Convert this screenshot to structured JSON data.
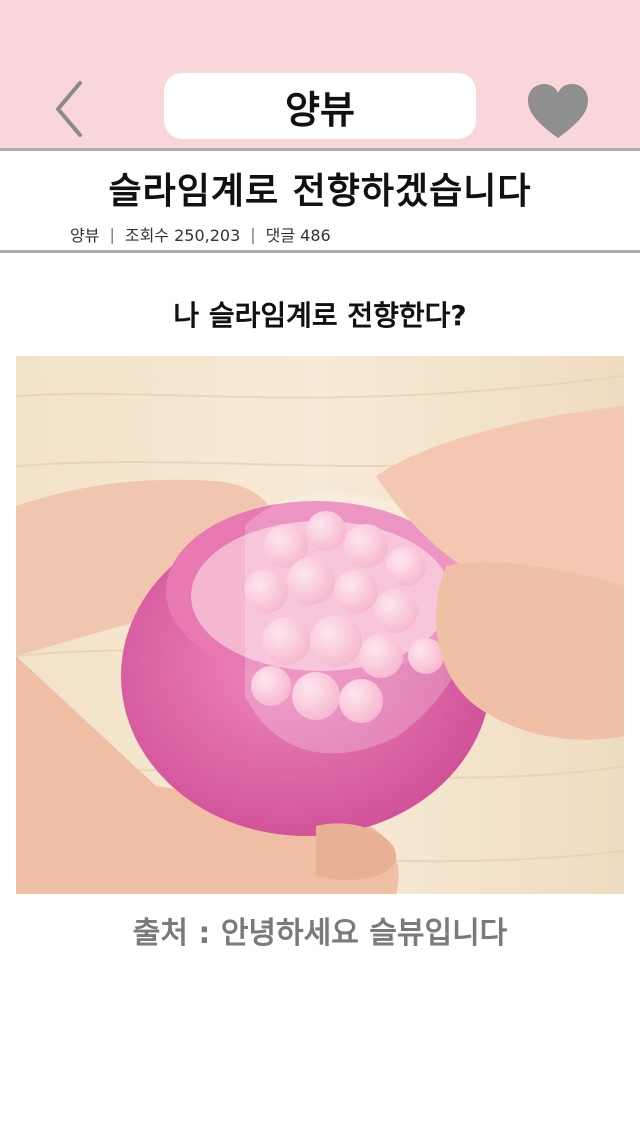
{
  "header": {
    "title": "양뷰",
    "back_icon": "chevron-left-icon",
    "heart_icon": "heart-icon",
    "background_color": "#f9d6da"
  },
  "article": {
    "title": "슬라임계로 전향하겠습니다",
    "meta": {
      "author": "양뷰",
      "views": "조회수 250,203",
      "comments": "댓글 486"
    }
  },
  "content": {
    "caption": "나 슬라임계로 전향한다?",
    "source": "출처 : 안녕하세요 슬뷰입니다"
  }
}
